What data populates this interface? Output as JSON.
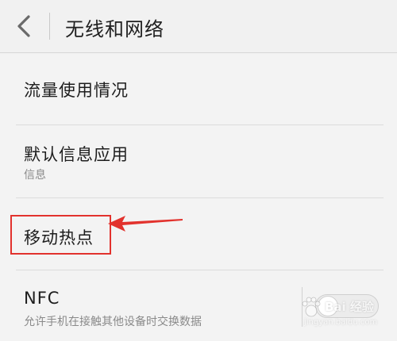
{
  "header": {
    "title": "无线和网络",
    "back_icon": "chevron-left-icon"
  },
  "rows": [
    {
      "title": "流量使用情况"
    },
    {
      "title": "默认信息应用",
      "subtitle": "信息"
    },
    {
      "title": "移动热点"
    },
    {
      "title": "NFC",
      "subtitle": "允许手机在接触其他设备时交换数据",
      "toggle_on": false
    }
  ],
  "annotation": {
    "box_color": "#e2322d",
    "arrow_color": "#e2322d"
  },
  "watermark": {
    "text": "Bai 经验",
    "url": "jingyan.baidu.com"
  },
  "colors": {
    "background": "#f3f3f3",
    "header_background": "#f1f1f1",
    "primary_text": "#1d1d1d",
    "secondary_text": "#8a8a8a"
  }
}
